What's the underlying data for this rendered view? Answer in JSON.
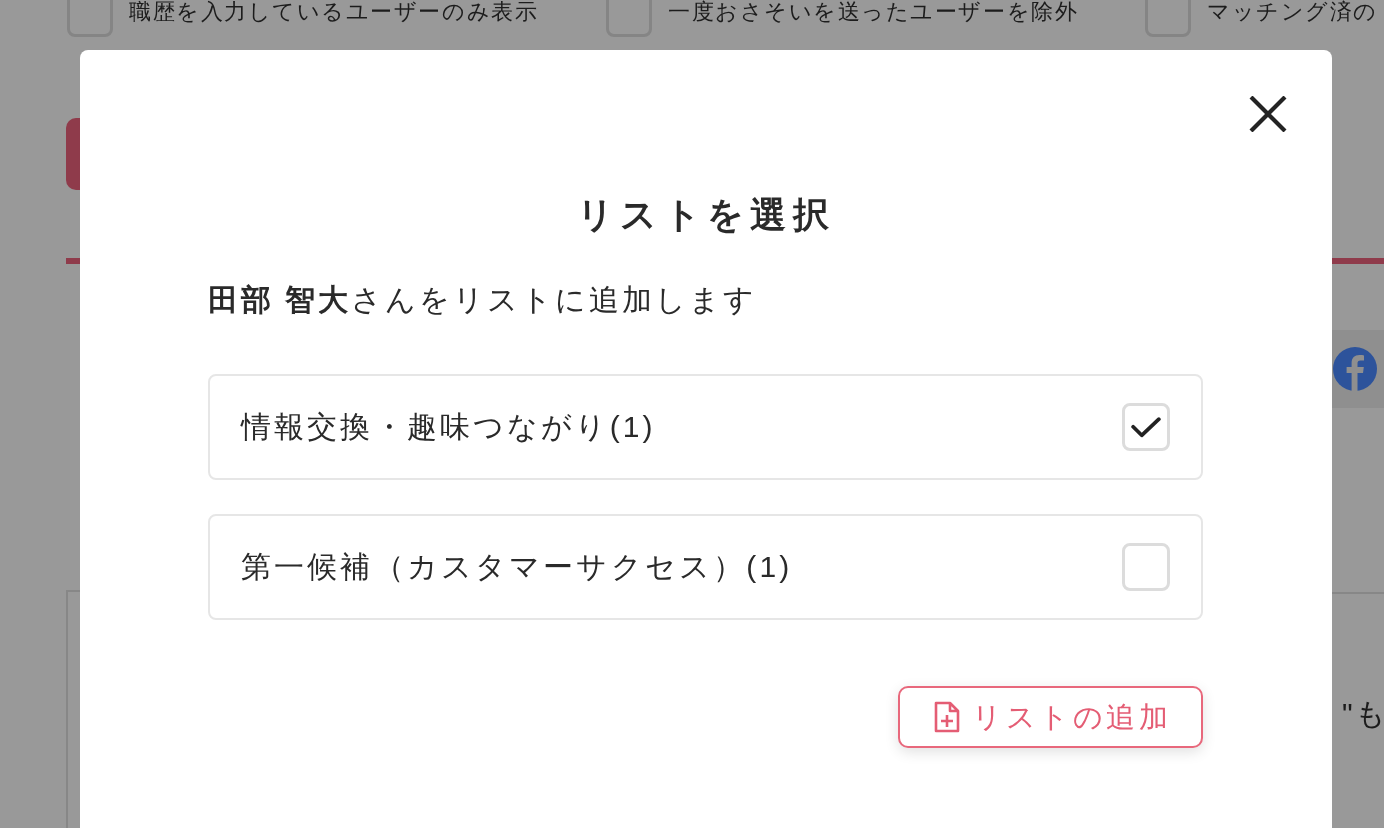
{
  "background": {
    "filters": [
      {
        "label": "職歴を入力しているユーザーのみ表示",
        "checked": false
      },
      {
        "label": "一度おさそいを送ったユーザーを除外",
        "checked": false
      },
      {
        "label": "マッチング済の",
        "checked": false
      }
    ],
    "side_text": "\"も"
  },
  "modal": {
    "title": "リストを選択",
    "subtitle": "**田部 智大**さんをリストに追加します",
    "lists": [
      {
        "label": "情報交換・趣味つながり(1)",
        "checked": true
      },
      {
        "label": "第一候補（カスタマーサクセス）(1)",
        "checked": false
      }
    ],
    "add_button": "リストの追加"
  }
}
